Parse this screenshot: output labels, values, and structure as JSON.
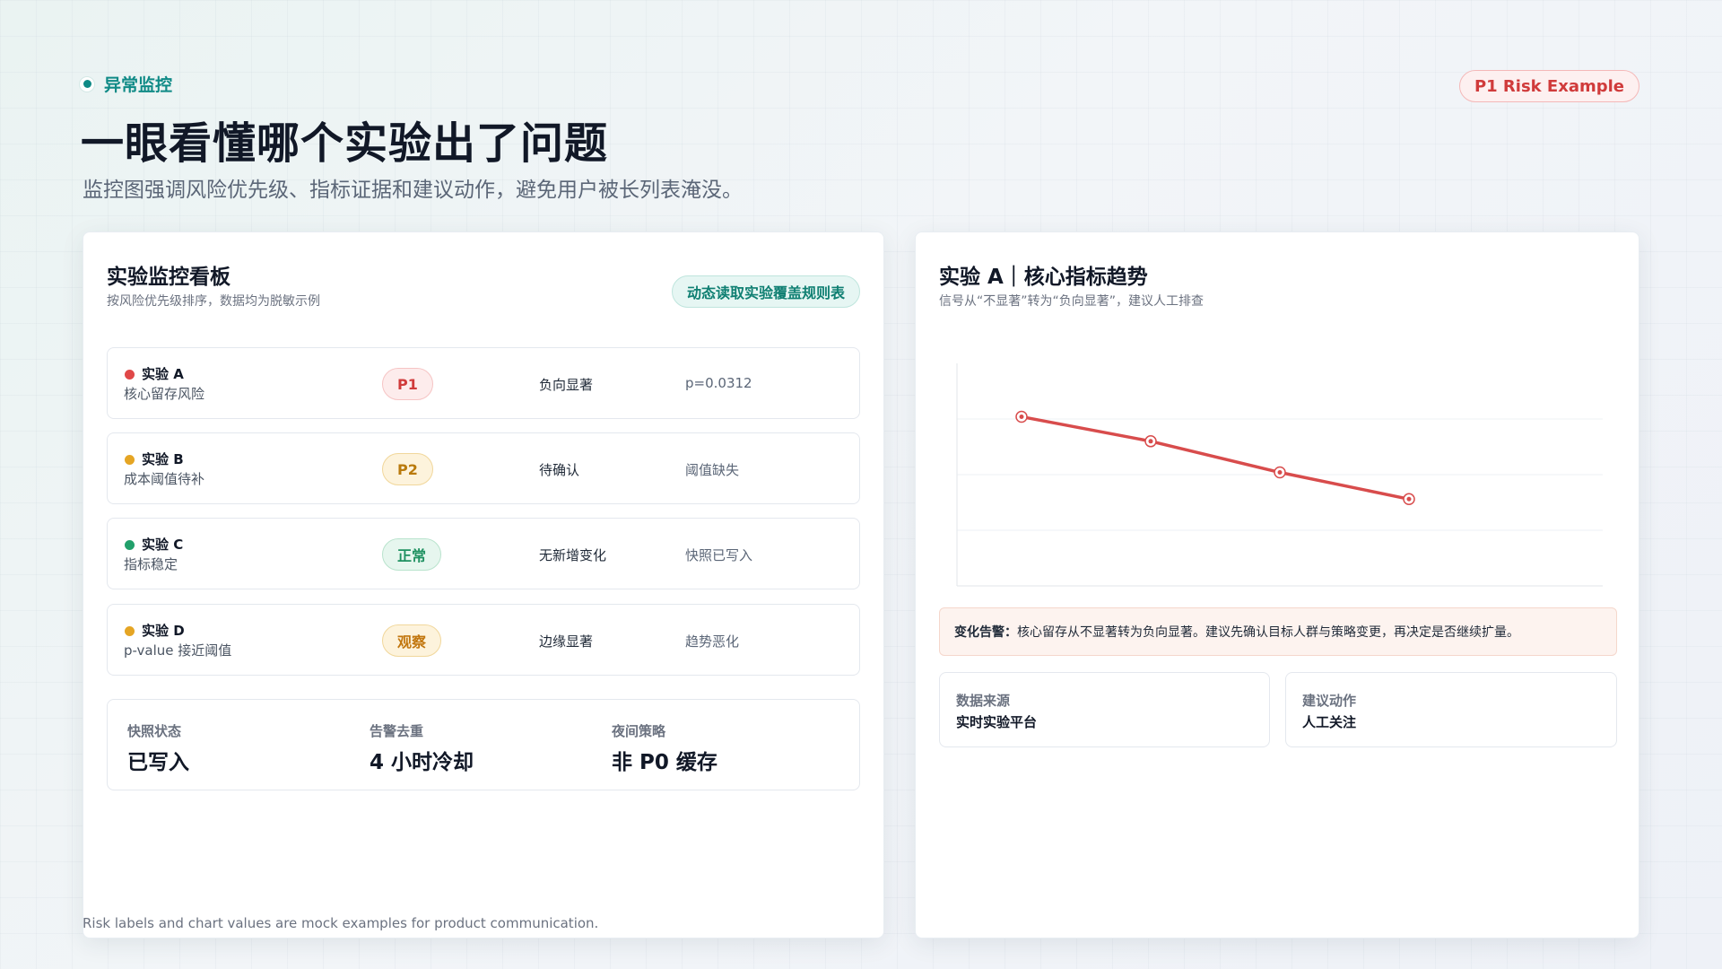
{
  "header": {
    "eyebrow": "异常监控",
    "title": "一眼看懂哪个实验出了问题",
    "subtitle": "监控图强调风险优先级、指标证据和建议动作，避免用户被长列表淹没。",
    "risk_pill": "P1 Risk Example"
  },
  "left_panel": {
    "title": "实验监控看板",
    "subtitle": "按风险优先级排序，数据均为脱敏示例",
    "rule_button": "动态读取实验覆盖规则表",
    "rows": [
      {
        "name": "实验 A",
        "desc": "核心留存风险",
        "badge": "P1",
        "status": "负向显著",
        "evidence": "p=0.0312",
        "dot_color": "#e04848",
        "badge_bg": "#fdecec",
        "badge_border": "#f6c4c4",
        "badge_color": "#d03b3b"
      },
      {
        "name": "实验 B",
        "desc": "成本阈值待补",
        "badge": "P2",
        "status": "待确认",
        "evidence": "阈值缺失",
        "dot_color": "#e5a524",
        "badge_bg": "#fdf3dc",
        "badge_border": "#f1d79b",
        "badge_color": "#b97a0d"
      },
      {
        "name": "实验 C",
        "desc": "指标稳定",
        "badge": "正常",
        "status": "无新增变化",
        "evidence": "快照已写入",
        "dot_color": "#22a06b",
        "badge_bg": "#e6f6ee",
        "badge_border": "#b9e3cd",
        "badge_color": "#1f9161"
      },
      {
        "name": "实验 D",
        "desc": "p-value 接近阈值",
        "badge": "观察",
        "status": "边缘显著",
        "evidence": "趋势恶化",
        "dot_color": "#e5a524",
        "badge_bg": "#fdf3dc",
        "badge_border": "#f1d79b",
        "badge_color": "#c2770f"
      }
    ],
    "stats": [
      {
        "label": "快照状态",
        "value": "已写入"
      },
      {
        "label": "告警去重",
        "value": "4 小时冷却"
      },
      {
        "label": "夜间策略",
        "value": "非 P0 缓存"
      }
    ]
  },
  "right_panel": {
    "title": "实验 A｜核心指标趋势",
    "subtitle": "信号从“不显著”转为“负向显著”，建议人工排查",
    "alert_label": "变化告警：",
    "alert_text": "核心留存从不显著转为负向显著。建议先确认目标人群与策略变更，再决定是否继续扩量。",
    "info": [
      {
        "label": "数据来源",
        "value": "实时实验平台"
      },
      {
        "label": "建议动作",
        "value": "人工关注"
      }
    ]
  },
  "chart_data": {
    "type": "line",
    "x": [
      1,
      2,
      3,
      4
    ],
    "values": [
      0.76,
      0.65,
      0.51,
      0.39
    ],
    "ylim": [
      0,
      1
    ],
    "grid": true,
    "line_color": "#d84c4c"
  },
  "footer": {
    "note": "Risk labels and chart values are mock examples for product communication."
  }
}
